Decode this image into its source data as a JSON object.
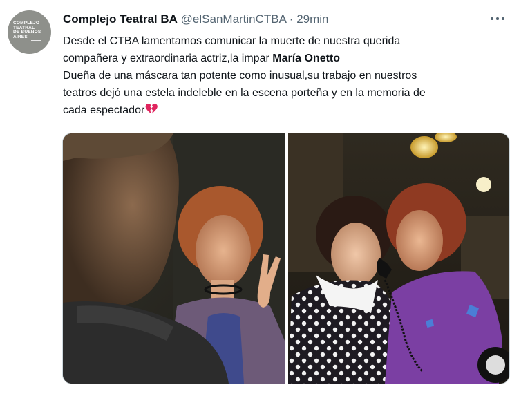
{
  "tweet": {
    "display_name": "Complejo Teatral BA",
    "handle": "@elSanMartinCTBA",
    "separator": "·",
    "time": "29min",
    "avatar": {
      "logo_lines": [
        "COMPLEJO",
        "TEATRAL",
        "DE BUENOS",
        "AIRES"
      ]
    },
    "text": {
      "line1": "Desde el CTBA lamentamos comunicar la muerte de nuestra querida",
      "line2_prefix": "compañera y extraordinaria actriz,la impar ",
      "line2_name": "María Onetto",
      "line3": "Dueña de una máscara tan potente como inusual,su trabajo en nuestros",
      "line4": "teatros dejó una estela indeleble en la escena porteña y en la memoria de",
      "line5": "cada espectador",
      "emoji": "broken-heart-icon"
    },
    "media": {
      "photos": [
        "photo-stage-scene-left",
        "photo-stage-scene-right"
      ]
    },
    "colors": {
      "text": "#0f1419",
      "secondary": "#536471",
      "heart": "#e0245e",
      "border": "#cfd9de"
    }
  }
}
